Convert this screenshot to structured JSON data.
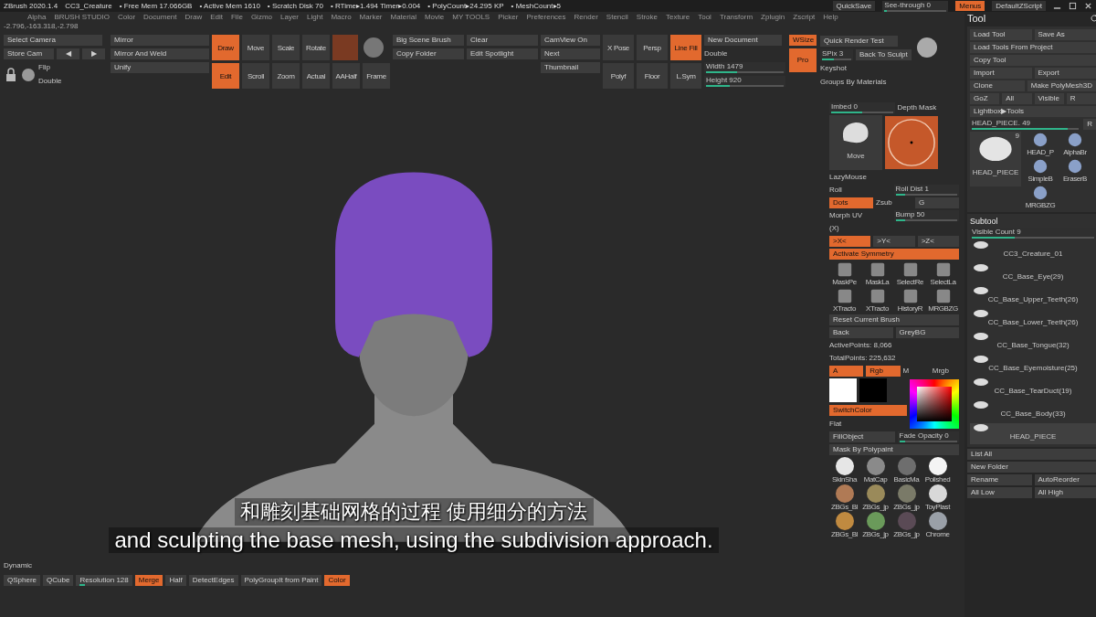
{
  "title_bar": {
    "app": "ZBrush 2020.1.4",
    "file": "CC3_Creature",
    "stats": [
      "• Free Mem 17.066GB",
      "• Active Mem 1610",
      "• Scratch Disk 70",
      "• RTime▸1.494 Timer▸0.004",
      "• PolyCount▸24.295 KP",
      "• MeshCount▸5"
    ],
    "quicksave": "QuickSave",
    "see_through": {
      "label": "See-through  0",
      "level": 0
    },
    "menus": {
      "label": "Menus",
      "on": true
    },
    "script": "DefaultZScript"
  },
  "menu_bar": [
    "Alpha",
    "BRUSH STUDIO",
    "Color",
    "Document",
    "Draw",
    "Edit",
    "File",
    "Gizmo",
    "Layer",
    "Light",
    "Macro",
    "Marker",
    "Material",
    "Movie",
    "MY TOOLS",
    "Picker",
    "Preferences",
    "Render",
    "Stencil",
    "Stroke",
    "Texture",
    "Tool",
    "Transform",
    "Zplugin",
    "Zscript",
    "Help"
  ],
  "coordinates": "-2.796,-163.318,-2.798",
  "toolbar": {
    "camera": [
      "Select Camera",
      "Store Cam",
      "◀",
      "▶"
    ],
    "flip": [
      "Flip",
      "Double"
    ],
    "mirror": [
      "Mirror",
      "Mirror And Weld",
      "Unify"
    ],
    "modes": [
      {
        "label": "Draw",
        "selected": true
      },
      {
        "label": "Move",
        "selected": false
      },
      {
        "label": "Scale",
        "selected": false
      },
      {
        "label": "Rotate",
        "selected": false
      }
    ],
    "modes2": [
      {
        "label": "Edit",
        "selected": true
      },
      {
        "label": "Scroll",
        "selected": false
      },
      {
        "label": "Zoom",
        "selected": false
      },
      {
        "label": "Actual",
        "selected": false
      },
      {
        "label": "AAHalf",
        "selected": false
      },
      {
        "label": "Frame",
        "selected": false
      }
    ],
    "scene": [
      "Big Scene Brush",
      "Clear",
      "Copy Folder",
      "Edit Spotlight"
    ],
    "camview": [
      "CamView On",
      "Next",
      "Thumbnail"
    ],
    "view_tools": [
      {
        "label": "X Pose",
        "selected": false
      },
      {
        "label": "Persp",
        "selected": false
      },
      {
        "label": "Line Fill",
        "selected": true
      },
      {
        "label": "Polyf",
        "selected": false
      },
      {
        "label": "Floor",
        "selected": false
      },
      {
        "label": "L.Sym",
        "selected": false
      }
    ],
    "document": {
      "new": "New Document",
      "wsize": {
        "label": "WSize",
        "on": true
      },
      "double": "Double",
      "width": {
        "label": "Width 1479",
        "level": 0.4
      },
      "height": {
        "label": "Height 920",
        "level": 0.3
      },
      "pro": {
        "label": "Pro",
        "on": true
      }
    },
    "render": {
      "quick": "Quick Render Test",
      "spix": {
        "label": "SPix 3",
        "level": 0.4
      },
      "back": "Back To Sculpt",
      "keyshot": "Keyshot",
      "groups": "Groups By Materials"
    }
  },
  "right_panel": [
    {
      "kind": "row",
      "items": [
        {
          "kind": "slider",
          "label": "Imbed 0",
          "level": 0.5
        },
        {
          "kind": "text",
          "label": "Depth Mask"
        }
      ]
    },
    {
      "kind": "previews",
      "brush": "Move"
    },
    {
      "kind": "row",
      "items": [
        {
          "kind": "text",
          "label": "LazyMouse"
        }
      ]
    },
    {
      "kind": "row",
      "items": [
        {
          "kind": "text",
          "label": "Roll"
        },
        {
          "kind": "slider",
          "label": "Roll Dist 1",
          "level": 0.15
        }
      ]
    },
    {
      "kind": "row",
      "items": [
        {
          "kind": "button",
          "label": "Dots",
          "on": true
        },
        {
          "kind": "text",
          "label": "Zsub"
        },
        {
          "kind": "button",
          "label": "G",
          "on": false
        }
      ]
    },
    {
      "kind": "row",
      "items": [
        {
          "kind": "text",
          "label": "Morph UV"
        },
        {
          "kind": "slider",
          "label": "Bump 50",
          "level": 0.15
        }
      ]
    },
    {
      "kind": "row",
      "items": [
        {
          "kind": "text",
          "label": "(X)"
        }
      ]
    },
    {
      "kind": "row",
      "items": [
        {
          "kind": "button",
          "label": ">X<",
          "on": true
        },
        {
          "kind": "button",
          "label": ">Y<",
          "on": false
        },
        {
          "kind": "button",
          "label": ">Z<",
          "on": false
        }
      ]
    },
    {
      "kind": "row",
      "items": [
        {
          "kind": "button",
          "label": "Activate Symmetry",
          "on": true
        }
      ]
    },
    {
      "kind": "icons",
      "items": [
        "MaskPe",
        "MaskLa",
        "SelectRe",
        "SelectLa"
      ]
    },
    {
      "kind": "icons",
      "items": [
        "XTracto",
        "XTracto",
        "HistoryR",
        "MRGBZG"
      ]
    },
    {
      "kind": "row",
      "items": [
        {
          "kind": "button",
          "label": "Reset Current Brush",
          "on": false
        }
      ]
    },
    {
      "kind": "row",
      "items": [
        {
          "kind": "button",
          "label": "Back",
          "on": false
        },
        {
          "kind": "button",
          "label": "GreyBG",
          "on": false
        }
      ]
    },
    {
      "kind": "row",
      "items": [
        {
          "kind": "text",
          "label": "ActivePoints: 8,066"
        }
      ]
    },
    {
      "kind": "row",
      "items": [
        {
          "kind": "text",
          "label": "TotalPoints: 225,632"
        }
      ]
    },
    {
      "kind": "row",
      "items": [
        {
          "kind": "button",
          "label": "A",
          "on": true
        },
        {
          "kind": "button",
          "label": "Rgb",
          "on": true
        },
        {
          "kind": "text",
          "label": "M"
        },
        {
          "kind": "text",
          "label": "Mrgb"
        }
      ]
    },
    {
      "kind": "color",
      "switch": {
        "label": "SwitchColor",
        "on": true
      },
      "flat": "Flat"
    },
    {
      "kind": "row",
      "items": [
        {
          "kind": "button",
          "label": "FillObject",
          "on": false
        },
        {
          "kind": "slider",
          "label": "Fade Opacity 0",
          "level": 0.1
        }
      ]
    },
    {
      "kind": "row",
      "items": [
        {
          "kind": "button",
          "label": "Mask By Polypaint",
          "on": false
        }
      ]
    },
    {
      "kind": "materials",
      "items": [
        {
          "label": "SkinSha",
          "color": "#e6e6e6"
        },
        {
          "label": "MatCap",
          "color": "#8a8a8a"
        },
        {
          "label": "BasicMa",
          "color": "#6e6e6e"
        },
        {
          "label": "Polished",
          "color": "#f4f4f4"
        },
        {
          "label": "ZBGs_Bl",
          "color": "#b07a55"
        },
        {
          "label": "ZBGs_jp",
          "color": "#9a8a5a"
        },
        {
          "label": "ZBGs_jp",
          "color": "#7a7a68"
        },
        {
          "label": "ToyPlast",
          "color": "#d8d8d8"
        },
        {
          "label": "ZBGs_Bl",
          "color": "#c08a40"
        },
        {
          "label": "ZBGs_jp",
          "color": "#6a9a5a"
        },
        {
          "label": "ZBGs_jp",
          "color": "#5a4a55"
        },
        {
          "label": "Chrome",
          "color": "#9aa0a8"
        }
      ]
    }
  ],
  "tool_panel": {
    "title": "Tool",
    "rows": [
      [
        {
          "label": "Load Tool",
          "on": false
        },
        {
          "label": "Save As",
          "on": false
        }
      ],
      [
        {
          "label": "Load Tools From Project",
          "on": false
        }
      ],
      [
        {
          "label": "Copy Tool",
          "on": false
        }
      ],
      [
        {
          "label": "Import",
          "on": false
        },
        {
          "label": "Export",
          "on": false
        }
      ],
      [
        {
          "label": "Clone",
          "on": false
        },
        {
          "label": "Make PolyMesh3D",
          "on": false
        }
      ],
      [
        {
          "label": "GoZ",
          "on": false
        },
        {
          "label": "All",
          "on": false
        },
        {
          "label": "Visible",
          "on": false
        },
        {
          "label": "R",
          "on": false
        }
      ],
      [
        {
          "label": "Lightbox▶Tools",
          "on": false
        }
      ]
    ],
    "current": {
      "label": "HEAD_PIECE. 49",
      "level": 0.9,
      "r": "R"
    },
    "thumbs": {
      "main": "HEAD_PIECE",
      "count": "9",
      "small": [
        "HEAD_P",
        "AlphaBr",
        "SimpleB",
        "EraserB",
        "MRGBZG"
      ]
    },
    "subtool": {
      "title": "Subtool",
      "visible": {
        "label": "Visible Count 9",
        "level": 0.35
      },
      "items": [
        {
          "name": "CC3_Creature_01",
          "selected": false
        },
        {
          "name": "CC_Base_Eye(29)",
          "selected": false
        },
        {
          "name": "CC_Base_Upper_Teeth(26)",
          "selected": false
        },
        {
          "name": "CC_Base_Lower_Teeth(26)",
          "selected": false
        },
        {
          "name": "CC_Base_Tongue(32)",
          "selected": false
        },
        {
          "name": "CC_Base_Eyemoisture(25)",
          "selected": false
        },
        {
          "name": "CC_Base_TearDuct(19)",
          "selected": false
        },
        {
          "name": "CC_Base_Body(33)",
          "selected": false
        },
        {
          "name": "HEAD_PIECE",
          "selected": true
        }
      ]
    },
    "bottom_rows": [
      [
        {
          "label": "List All",
          "on": false
        }
      ],
      [
        {
          "label": "New Folder",
          "on": false
        }
      ],
      [
        {
          "label": "Rename",
          "on": false
        },
        {
          "label": "AutoReorder",
          "on": false
        }
      ],
      [
        {
          "label": "All Low",
          "on": false
        },
        {
          "label": "All High",
          "on": false
        }
      ]
    ]
  },
  "bottom_bar": {
    "dynamic": "Dynamic",
    "items": [
      {
        "label": "QSphere",
        "on": false
      },
      {
        "label": "QCube",
        "on": false
      },
      {
        "label": "Resolution 128",
        "on": false,
        "level": 0.1
      },
      {
        "label": "Merge",
        "on": true
      },
      {
        "label": "Half",
        "on": false
      },
      {
        "label": "DetectEdges",
        "on": false
      },
      {
        "label": "PolyGroupIt from Paint",
        "on": false
      },
      {
        "label": "Color",
        "on": true
      }
    ]
  },
  "subtitles": {
    "zh": "和雕刻基础网格的过程 使用细分的方法",
    "en": "and sculpting the base mesh, using the subdivision approach."
  }
}
